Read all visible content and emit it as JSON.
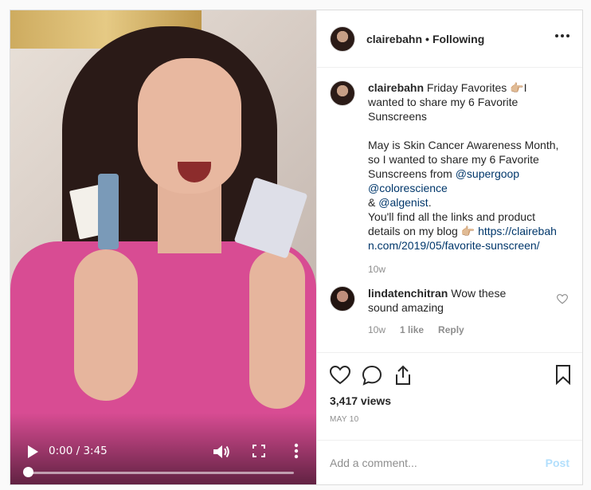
{
  "video": {
    "time": "0:00 / 3:45",
    "progress": 0,
    "icons": [
      "play-icon",
      "volume-icon",
      "fullscreen-icon",
      "more-vertical-icon"
    ]
  },
  "header": {
    "username": "clairebahn",
    "separator": "•",
    "follow_state": "Following"
  },
  "caption": {
    "username": "clairebahn",
    "line1": "Friday Favorites 👉🏼I wanted to share my 6 Favorite Sunscreens",
    "p2_text": "May is Skin Cancer Awareness Month, so I wanted to share my 6 Favorite Sunscreens from",
    "mention1": "@supergoop",
    "mention2": "@colorescience",
    "amp": "&",
    "mention3": "@algenist",
    "after_mention": ".",
    "p3_text": "You'll find all the links and product details on my blog 👉🏼",
    "link": "https://clairebahn.com/2019/05/favorite-sunscreen/",
    "age": "10w"
  },
  "comment": {
    "username": "lindatenchitran",
    "text": "Wow these sound amazing",
    "age": "10w",
    "likes": "1 like",
    "reply": "Reply"
  },
  "stats": {
    "views": "3,417 views",
    "date": "MAY 10"
  },
  "add_comment": {
    "placeholder": "Add a comment...",
    "post": "Post"
  },
  "colors": {
    "link": "#00376b",
    "post_disabled": "#b2dffc",
    "muted": "#8e8e8e"
  }
}
